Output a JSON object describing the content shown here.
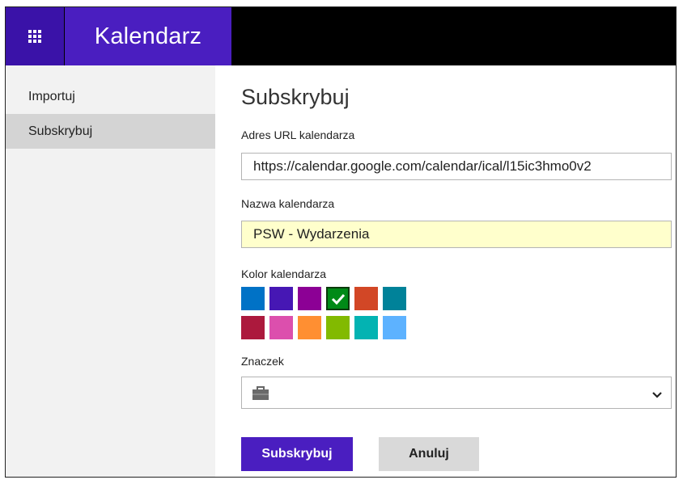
{
  "app": {
    "name": "Kalendarz"
  },
  "sidebar": {
    "items": [
      {
        "label": "Importuj",
        "active": false
      },
      {
        "label": "Subskrybuj",
        "active": true
      }
    ]
  },
  "form": {
    "title": "Subskrybuj",
    "url": {
      "label": "Adres URL kalendarza",
      "value": "https://calendar.google.com/calendar/ical/l15ic3hmo0v2"
    },
    "name": {
      "label": "Nazwa kalendarza",
      "value": "PSW - Wydarzenia"
    },
    "color": {
      "label": "Kolor kalendarza",
      "swatches": [
        "#0072c6",
        "#4617b4",
        "#8c0095",
        "#008a17",
        "#d24726",
        "#008299",
        "#ac193d",
        "#dc4fad",
        "#ff8f32",
        "#82ba00",
        "#03b3b2",
        "#5db2ff"
      ],
      "selected_index": 3
    },
    "charm": {
      "label": "Znaczek",
      "selected_icon": "briefcase-icon"
    },
    "buttons": {
      "subscribe": "Subskrybuj",
      "cancel": "Anuluj"
    }
  },
  "colors": {
    "accent": "#4a1ec0",
    "accent_dark": "#3a12a8",
    "input_highlight": "#ffffcc"
  }
}
